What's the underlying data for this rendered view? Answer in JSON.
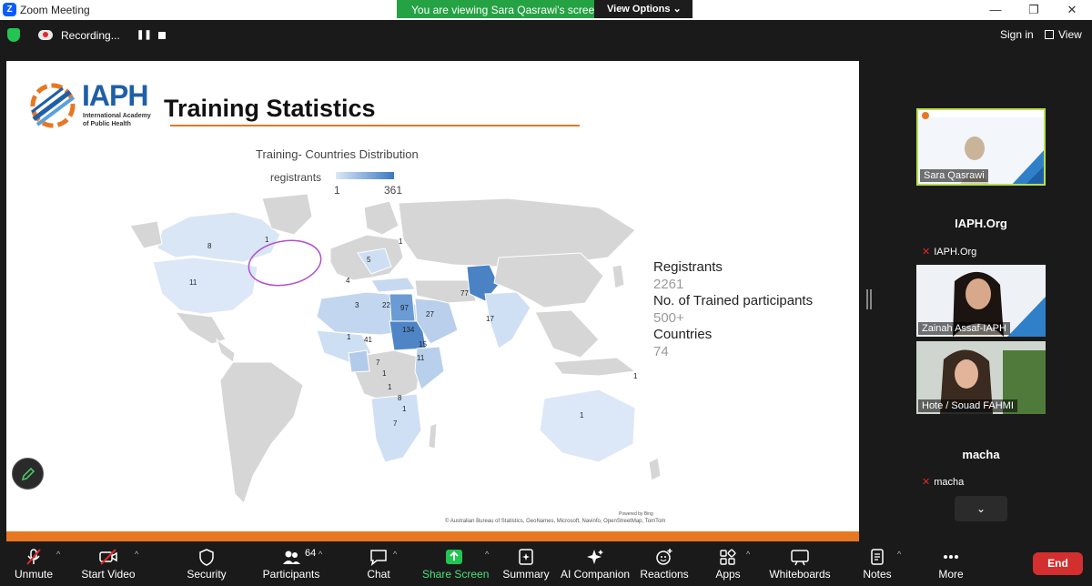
{
  "window": {
    "app_title": "Zoom Meeting",
    "logo_letter": "Z",
    "banner_text": "You are viewing Sara Qasrawi's screen",
    "view_options": "View Options",
    "minimize": "—",
    "restore": "❐",
    "close": "✕"
  },
  "topbar": {
    "recording_label": "Recording...",
    "pause_icon": "❚❚",
    "sign_in": "Sign in",
    "view": "View"
  },
  "slide": {
    "logo_text": "IAPH",
    "logo_sub_line1": "International Academy",
    "logo_sub_line2": "of Public Health",
    "title": "Training Statistics",
    "chart_title": "Training- Countries Distribution",
    "legend_label": "registrants",
    "legend_min": "1",
    "legend_max": "361",
    "map_credit_1": "Powered by Bing",
    "map_credit_2": "© Australian Bureau of Statistics, GeoNames, Microsoft, Navinfo, OpenStreetMap, TomTom",
    "stats": [
      {
        "label": "Registrants",
        "value": "2261"
      },
      {
        "label": "No. of Trained participants",
        "value": "500+"
      },
      {
        "label": "Countries",
        "value": "74"
      }
    ],
    "map_labels": [
      "8",
      "11",
      "1",
      "5",
      "1",
      "4",
      "3",
      "22",
      "97",
      "27",
      "77",
      "17",
      "134",
      "41",
      "1",
      "7",
      "15",
      "1",
      "11",
      "1",
      "8",
      "1",
      "7",
      "1",
      "1"
    ],
    "colors": {
      "accent": "#e87722",
      "brand": "#1f5fa8",
      "scale_low": "#dce8f7",
      "scale_high": "#3c79c2"
    }
  },
  "participants": [
    {
      "name": "Sara Qasrawi",
      "type": "video",
      "active": true
    },
    {
      "name": "IAPH.Org",
      "type": "muted"
    },
    {
      "name": "Zainah Assaf-IAPH",
      "type": "video"
    },
    {
      "name": "Hote / Souad FAHMI",
      "type": "video"
    },
    {
      "name": "macha",
      "type": "muted"
    }
  ],
  "panel": {
    "scroll_icon": "chevron-down"
  },
  "toolbar": {
    "unmute": "Unmute",
    "start_video": "Start Video",
    "security": "Security",
    "participants": "Participants",
    "participants_count": "64",
    "chat": "Chat",
    "share_screen": "Share Screen",
    "summary": "Summary",
    "ai_companion": "AI Companion",
    "reactions": "Reactions",
    "apps": "Apps",
    "whiteboards": "Whiteboards",
    "notes": "Notes",
    "more": "More",
    "end": "End"
  }
}
